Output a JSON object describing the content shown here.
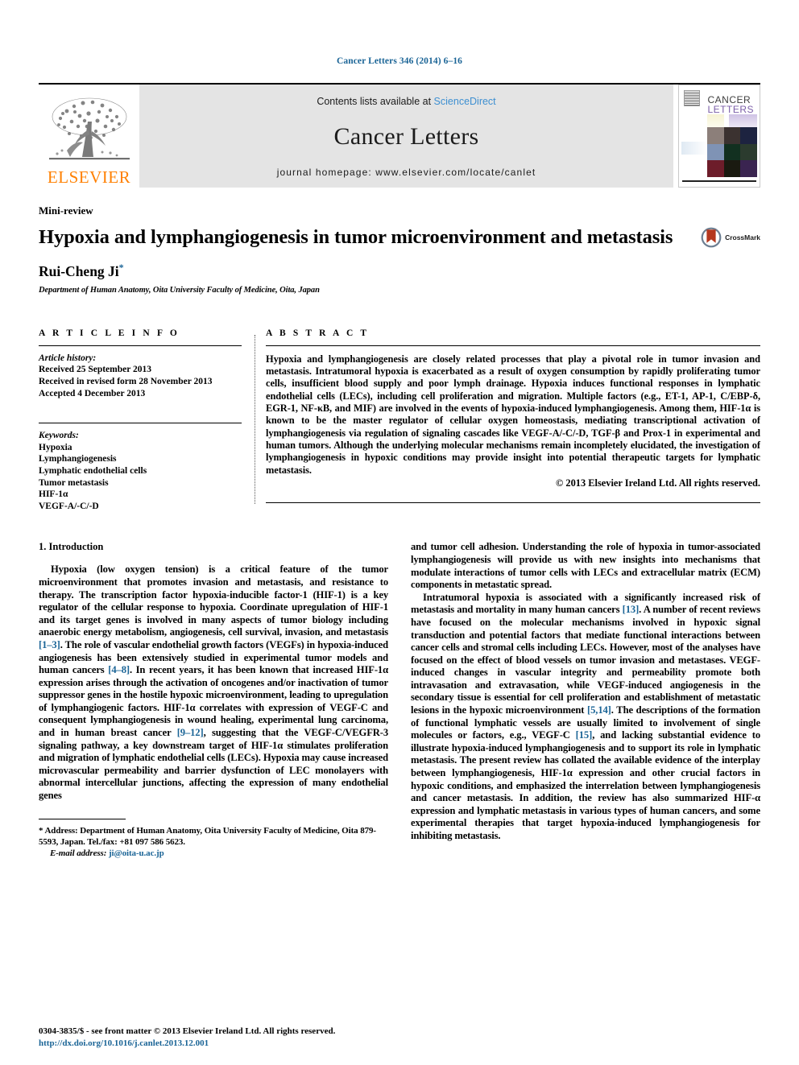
{
  "running_head": "Cancer Letters 346 (2014) 6–16",
  "masthead": {
    "publisher_logo_text": "ELSEVIER",
    "contents_prefix": "Contents lists available at",
    "contents_link": "ScienceDirect",
    "journal_title": "Cancer Letters",
    "homepage_line": "journal homepage: www.elsevier.com/locate/canlet",
    "cover": {
      "line1": "CANCER",
      "line2": "LETTERS"
    }
  },
  "article": {
    "type": "Mini-review",
    "title": "Hypoxia and lymphangiogenesis in tumor microenvironment and metastasis",
    "crossmark_label": "CrossMark",
    "author": "Rui-Cheng Ji",
    "author_marker": "*",
    "affiliation": "Department of Human Anatomy, Oita University Faculty of Medicine, Oita, Japan"
  },
  "article_info": {
    "heading": "A R T I C L E    I N F O",
    "history_label": "Article history:",
    "history": [
      "Received 25 September 2013",
      "Received in revised form 28 November 2013",
      "Accepted 4 December 2013"
    ],
    "keywords_label": "Keywords:",
    "keywords": [
      "Hypoxia",
      "Lymphangiogenesis",
      "Lymphatic endothelial cells",
      "Tumor metastasis",
      "HIF-1α",
      "VEGF-A/-C/-D"
    ]
  },
  "abstract": {
    "heading": "A B S T R A C T",
    "text": "Hypoxia and lymphangiogenesis are closely related processes that play a pivotal role in tumor invasion and metastasis. Intratumoral hypoxia is exacerbated as a result of oxygen consumption by rapidly proliferating tumor cells, insufficient blood supply and poor lymph drainage. Hypoxia induces functional responses in lymphatic endothelial cells (LECs), including cell proliferation and migration. Multiple factors (e.g., ET-1, AP-1, C/EBP-δ, EGR-1, NF-κB, and MIF) are involved in the events of hypoxia-induced lymphangiogenesis. Among them, HIF-1α is known to be the master regulator of cellular oxygen homeostasis, mediating transcriptional activation of lymphangiogenesis via regulation of signaling cascades like VEGF-A/-C/-D, TGF-β and Prox-1 in experimental and human tumors. Although the underlying molecular mechanisms remain incompletely elucidated, the investigation of lymphangiogenesis in hypoxic conditions may provide insight into potential therapeutic targets for lymphatic metastasis.",
    "copyright": "© 2013 Elsevier Ireland Ltd. All rights reserved."
  },
  "body": {
    "section_title": "1. Introduction",
    "left_paragraphs": [
      "Hypoxia (low oxygen tension) is a critical feature of the tumor microenvironment that promotes invasion and metastasis, and resistance to therapy. The transcription factor hypoxia-inducible factor-1 (HIF-1) is a key regulator of the cellular response to hypoxia. Coordinate upregulation of HIF-1 and its target genes is involved in many aspects of tumor biology including anaerobic energy metabolism, angiogenesis, cell survival, invasion, and metastasis [1–3]. The role of vascular endothelial growth factors (VEGFs) in hypoxia-induced angiogenesis has been extensively studied in experimental tumor models and human cancers [4–8]. In recent years, it has been known that increased HIF-1α expression arises through the activation of oncogenes and/or inactivation of tumor suppressor genes in the hostile hypoxic microenvironment, leading to upregulation of lymphangiogenic factors. HIF-1α correlates with expression of VEGF-C and consequent lymphangiogenesis in wound healing, experimental lung carcinoma, and in human breast cancer [9–12], suggesting that the VEGF-C/VEGFR-3 signaling pathway, a key downstream target of HIF-1α stimulates proliferation and migration of lymphatic endothelial cells (LECs). Hypoxia may cause increased microvascular permeability and barrier dysfunction of LEC monolayers with abnormal intercellular junctions, affecting the expression of many endothelial genes"
    ],
    "right_paragraphs": [
      "and tumor cell adhesion. Understanding the role of hypoxia in tumor-associated lymphangiogenesis will provide us with new insights into mechanisms that modulate interactions of tumor cells with LECs and extracellular matrix (ECM) components in metastatic spread.",
      "Intratumoral hypoxia is associated with a significantly increased risk of metastasis and mortality in many human cancers [13]. A number of recent reviews have focused on the molecular mechanisms involved in hypoxic signal transduction and potential factors that mediate functional interactions between cancer cells and stromal cells including LECs. However, most of the analyses have focused on the effect of blood vessels on tumor invasion and metastases. VEGF-induced changes in vascular integrity and permeability promote both intravasation and extravasation, while VEGF-induced angiogenesis in the secondary tissue is essential for cell proliferation and establishment of metastatic lesions in the hypoxic microenvironment [5,14]. The descriptions of the formation of functional lymphatic vessels are usually limited to involvement of single molecules or factors, e.g., VEGF-C [15], and lacking substantial evidence to illustrate hypoxia-induced lymphangiogenesis and to support its role in lymphatic metastasis. The present review has collated the available evidence of the interplay between lymphangiogenesis, HIF-1α expression and other crucial factors in hypoxic conditions, and emphasized the interrelation between lymphangiogenesis and cancer metastasis. In addition, the review has also summarized HIF-α expression and lymphatic metastasis in various types of human cancers, and some experimental therapies that target hypoxia-induced lymphangiogenesis for inhibiting metastasis."
    ]
  },
  "footnote": {
    "marker": "*",
    "address": "Address: Department of Human Anatomy, Oita University Faculty of Medicine, Oita 879-5593, Japan. Tel./fax: +81 097 586 5623.",
    "email_label": "E-mail address:",
    "email": "ji@oita-u.ac.jp"
  },
  "page_footer": {
    "copyright": "0304-3835/$ - see front matter © 2013 Elsevier Ireland Ltd. All rights reserved.",
    "doi": "http://dx.doi.org/10.1016/j.canlet.2013.12.001"
  },
  "colors": {
    "link": "#1a6496",
    "elsevier_orange": "#ff8000",
    "sciencedirect": "#3d8fd1",
    "masthead_gray": "#e4e4e4",
    "crossmark_red": "#b5381f",
    "crossmark_blue": "#6d7f92"
  }
}
